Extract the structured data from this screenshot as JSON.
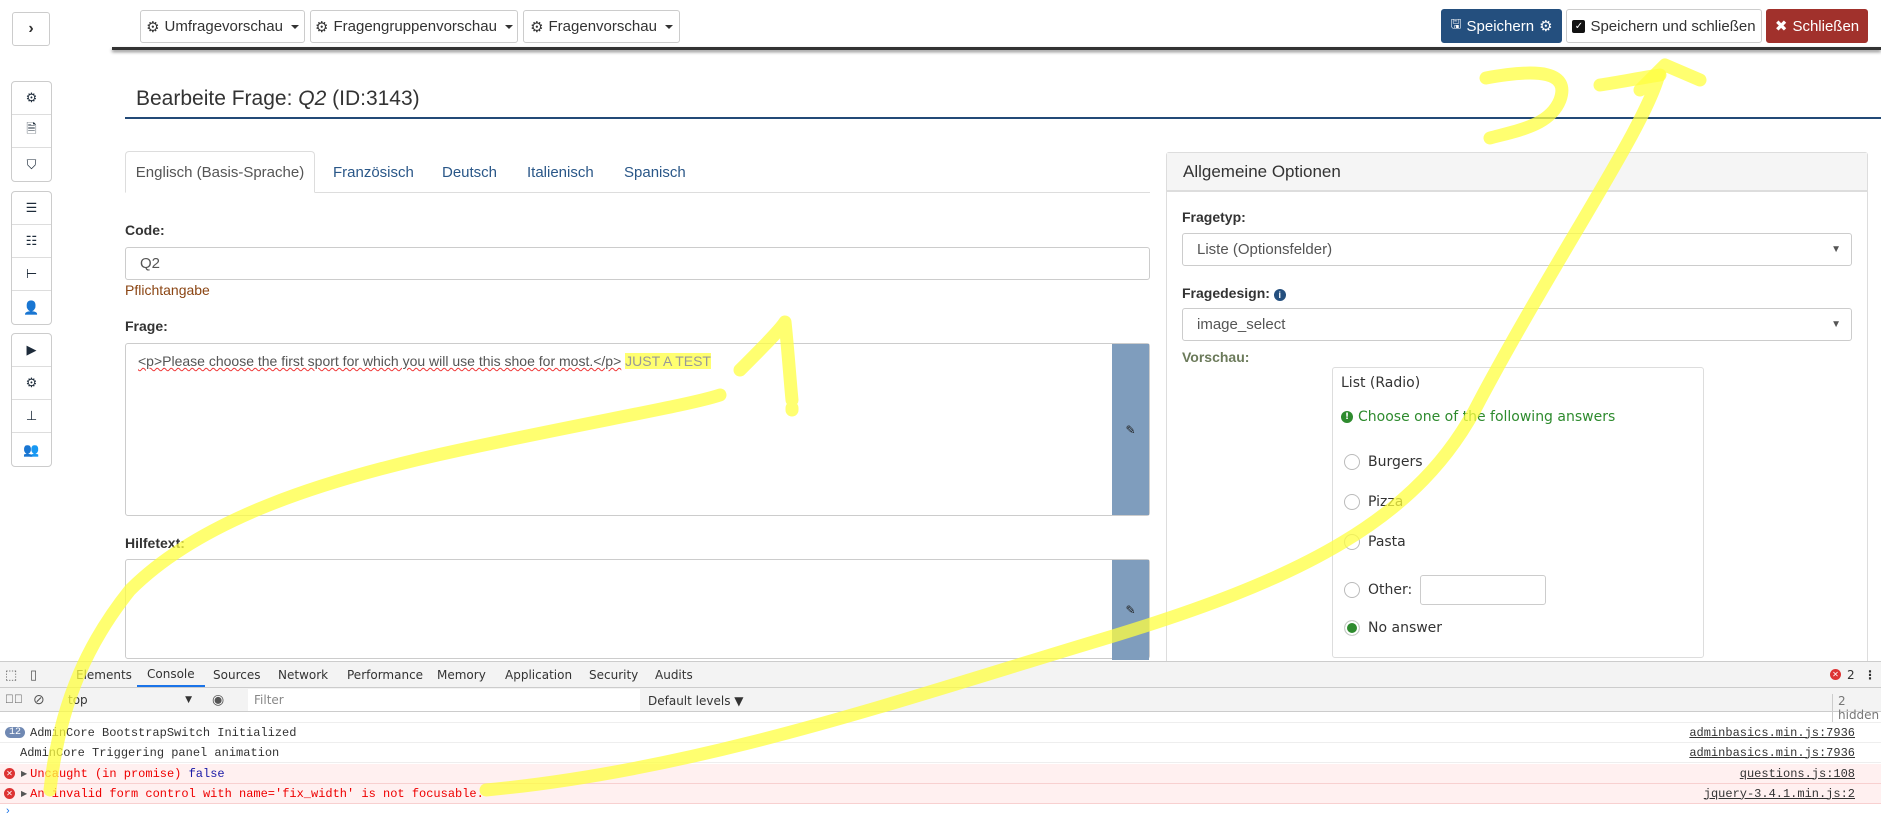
{
  "topbar": {
    "left_buttons": [
      {
        "label": "Umfragevorschau",
        "icon": "gear-icon"
      },
      {
        "label": "Fragengruppenvorschau",
        "icon": "gear-icon"
      },
      {
        "label": "Fragenvorschau",
        "icon": "gear-icon"
      }
    ],
    "save": "Speichern",
    "save_close": "Speichern und schließen",
    "close": "Schließen"
  },
  "sidebar": {
    "toggle_icon": "chevron-right-icon",
    "groups": [
      [
        "cogs-icon",
        "file-icon",
        "shield-icon"
      ],
      [
        "list-icon",
        "list-ul-icon",
        "tree-icon",
        "user-icon"
      ],
      [
        "play-icon",
        "gear-icon",
        "sitemap-icon",
        "users-icon"
      ]
    ]
  },
  "page": {
    "title_prefix": "Bearbeite Frage: ",
    "title_code": "Q2",
    "title_id": "(ID:3143)"
  },
  "tabs": [
    "Englisch (Basis-Sprache)",
    "Französisch",
    "Deutsch",
    "Italienisch",
    "Spanisch"
  ],
  "form": {
    "code_label": "Code:",
    "code_value": "Q2",
    "code_hint": "Pflichtangabe",
    "question_label": "Frage:",
    "question_value": "<p>Please choose the first sport for which you will use this shoe for most.</p>",
    "question_extra": "JUST A TEST",
    "help_label": "Hilfetext:",
    "help_value": ""
  },
  "options": {
    "header": "Allgemeine Optionen",
    "type_label": "Fragetyp:",
    "type_value": "Liste (Optionsfelder)",
    "design_label": "Fragedesign:",
    "design_value": "image_select",
    "preview_label": "Vorschau:",
    "preview": {
      "title": "List (Radio)",
      "hint": "Choose one of the following answers",
      "answers": [
        "Burgers",
        "Pizza",
        "Pasta"
      ],
      "other_label": "Other:",
      "no_answer": "No answer",
      "selected": "No answer"
    }
  },
  "devtools": {
    "tabs": [
      "Elements",
      "Console",
      "Sources",
      "Network",
      "Performance",
      "Memory",
      "Application",
      "Security",
      "Audits"
    ],
    "active_tab": "Console",
    "context": "top",
    "filter_placeholder": "Filter",
    "levels": "Default levels ▼",
    "hidden": "2 hidden",
    "error_count": "2",
    "logs": [
      {
        "count": "12",
        "text": "AdminCore BootstrapSwitch Initialized",
        "source": "adminbasics.min.js:7936",
        "type": "info"
      },
      {
        "text": "AdminCore Triggering panel animation",
        "source": "adminbasics.min.js:7936",
        "type": "info"
      },
      {
        "text": "Uncaught (in promise)",
        "value": "false",
        "source": "questions.js:108",
        "type": "error"
      },
      {
        "text": "An invalid form control with name='fix_width' is not focusable.",
        "source": "jquery-3.4.1.min.js:2",
        "type": "error"
      }
    ]
  },
  "colors": {
    "primary": "#244f7e",
    "danger": "#a1312c",
    "success": "#2e8b2e",
    "highlight": "#ffff55"
  }
}
